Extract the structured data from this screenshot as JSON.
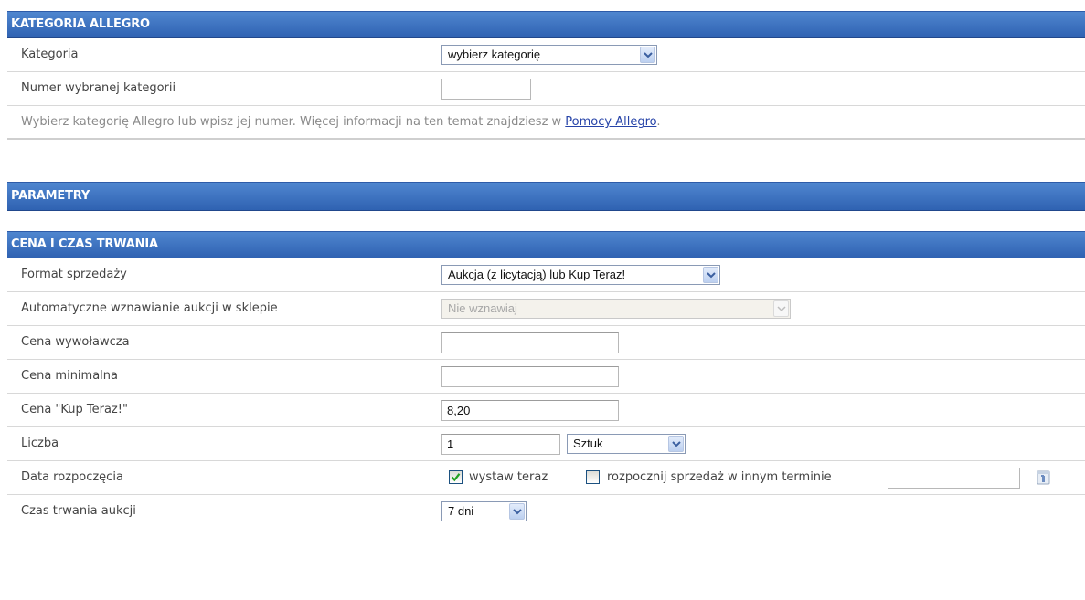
{
  "kategoria_section": {
    "title": "KATEGORIA ALLEGRO",
    "kategoria_label": "Kategoria",
    "kategoria_select": "wybierz kategorię",
    "numer_label": "Numer wybranej kategorii",
    "numer_value": "",
    "info_text": "Wybierz kategorię Allegro lub wpisz jej numer. Więcej informacji na ten temat znajdziesz w ",
    "info_link": "Pomocy Allegro",
    "info_end": "."
  },
  "parametry_section": {
    "title": "PARAMETRY"
  },
  "cena_section": {
    "title": "CENA I CZAS TRWANIA",
    "format_label": "Format sprzedaży",
    "format_select": "Aukcja (z licytacją) lub Kup Teraz!",
    "wznawianie_label": "Automatyczne wznawianie aukcji w sklepie",
    "wznawianie_select": "Nie wznawiaj",
    "wywolawcza_label": "Cena wywoławcza",
    "wywolawcza_value": "",
    "minimalna_label": "Cena minimalna",
    "minimalna_value": "",
    "kup_teraz_label": "Cena \"Kup Teraz!\"",
    "kup_teraz_value": "8,20",
    "liczba_label": "Liczba",
    "liczba_value": "1",
    "liczba_unit": "Sztuk",
    "data_label": "Data rozpoczęcia",
    "wystaw_teraz_label": "wystaw teraz",
    "wystaw_teraz_checked": true,
    "inny_termin_label": "rozpocznij sprzedaż w innym terminie",
    "inny_termin_checked": false,
    "inny_termin_value": "",
    "czas_label": "Czas trwania aukcji",
    "czas_select": "7 dni"
  },
  "colors": {
    "header_blue": "#2f62b2",
    "link": "#2643a8"
  },
  "icons": {
    "dropdown": "chevron-down-icon",
    "checkbox": "check-icon",
    "calendar": "calendar-icon"
  }
}
